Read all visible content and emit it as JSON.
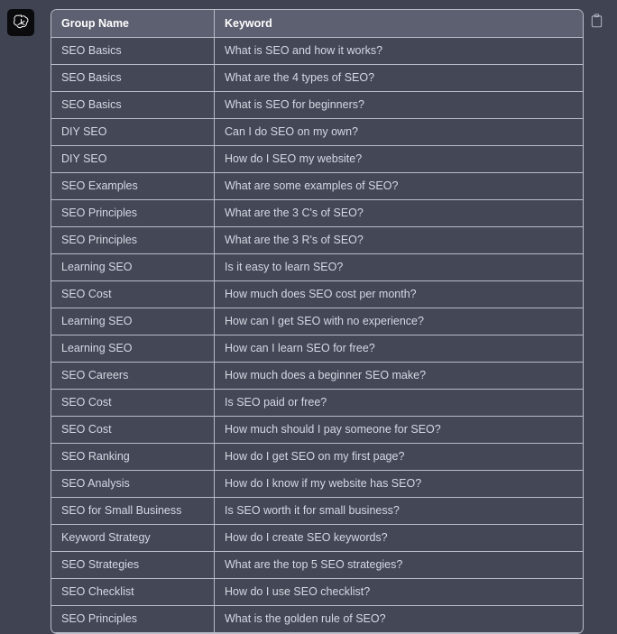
{
  "avatar": {
    "icon": "openai-logo-icon",
    "alt": "ChatGPT"
  },
  "toolbar": {
    "copy_icon": "clipboard-copy-icon",
    "copy_label": "Copy"
  },
  "table": {
    "columns": [
      "Group Name",
      "Keyword"
    ],
    "rows": [
      [
        "SEO Basics",
        "What is SEO and how it works?"
      ],
      [
        "SEO Basics",
        "What are the 4 types of SEO?"
      ],
      [
        "SEO Basics",
        "What is SEO for beginners?"
      ],
      [
        "DIY SEO",
        "Can I do SEO on my own?"
      ],
      [
        "DIY SEO",
        "How do I SEO my website?"
      ],
      [
        "SEO Examples",
        "What are some examples of SEO?"
      ],
      [
        "SEO Principles",
        "What are the 3 C's of SEO?"
      ],
      [
        "SEO Principles",
        "What are the 3 R's of SEO?"
      ],
      [
        "Learning SEO",
        "Is it easy to learn SEO?"
      ],
      [
        "SEO Cost",
        "How much does SEO cost per month?"
      ],
      [
        "Learning SEO",
        "How can I get SEO with no experience?"
      ],
      [
        "Learning SEO",
        "How can I learn SEO for free?"
      ],
      [
        "SEO Careers",
        "How much does a beginner SEO make?"
      ],
      [
        "SEO Cost",
        "Is SEO paid or free?"
      ],
      [
        "SEO Cost",
        "How much should I pay someone for SEO?"
      ],
      [
        "SEO Ranking",
        "How do I get SEO on my first page?"
      ],
      [
        "SEO Analysis",
        "How do I know if my website has SEO?"
      ],
      [
        "SEO for Small Business",
        "Is SEO worth it for small business?"
      ],
      [
        "Keyword Strategy",
        "How do I create SEO keywords?"
      ],
      [
        "SEO Strategies",
        "What are the top 5 SEO strategies?"
      ],
      [
        "SEO Checklist",
        "How do I use SEO checklist?"
      ],
      [
        "SEO Principles",
        "What is the golden rule of SEO?"
      ]
    ]
  },
  "colors": {
    "page_background": "#3f4352",
    "table_background": "#434756",
    "header_background": "#5c6070",
    "border": "#b9bdca",
    "body_text": "#d6d9e3",
    "header_text": "#ffffff"
  }
}
